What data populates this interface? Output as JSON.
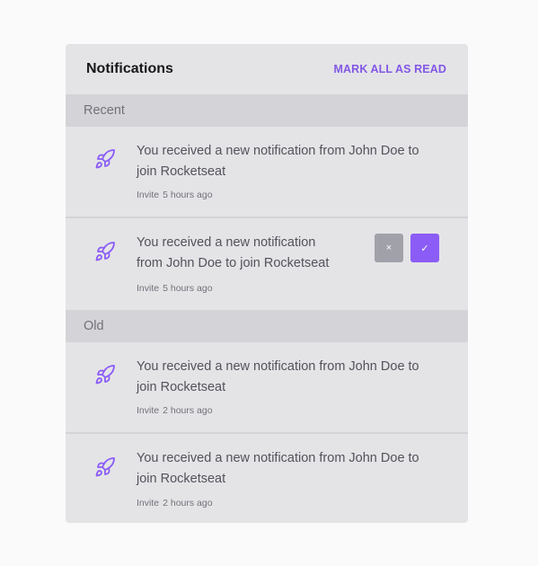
{
  "header": {
    "title": "Notifications",
    "mark_all_label": "MARK ALL AS READ"
  },
  "groups": [
    {
      "label": "Recent",
      "items": [
        {
          "message": "You received a new notification from John Doe to join Rocketseat",
          "type": "Invite",
          "time": "5 hours ago",
          "icon": "rocket-icon"
        },
        {
          "message": "You received a new notification from John Doe to join Rocketseat",
          "type": "Invite",
          "time": "5 hours ago",
          "icon": "rocket-icon",
          "actions": {
            "decline": "×",
            "accept": "✓"
          }
        }
      ]
    },
    {
      "label": "Old",
      "items": [
        {
          "message": "You received a new notification from John Doe to join Rocketseat",
          "type": "Invite",
          "time": "2 hours ago",
          "icon": "rocket-icon"
        },
        {
          "message": "You received a new notification from John Doe to join Rocketseat",
          "type": "Invite",
          "time": "2 hours ago",
          "icon": "rocket-icon"
        }
      ]
    }
  ],
  "colors": {
    "accent": "#8257e5",
    "icon": "#8b5cf6",
    "panel_bg": "#e4e4e7",
    "group_bg": "#d4d4d8",
    "decline_bg": "#a1a1aa"
  }
}
